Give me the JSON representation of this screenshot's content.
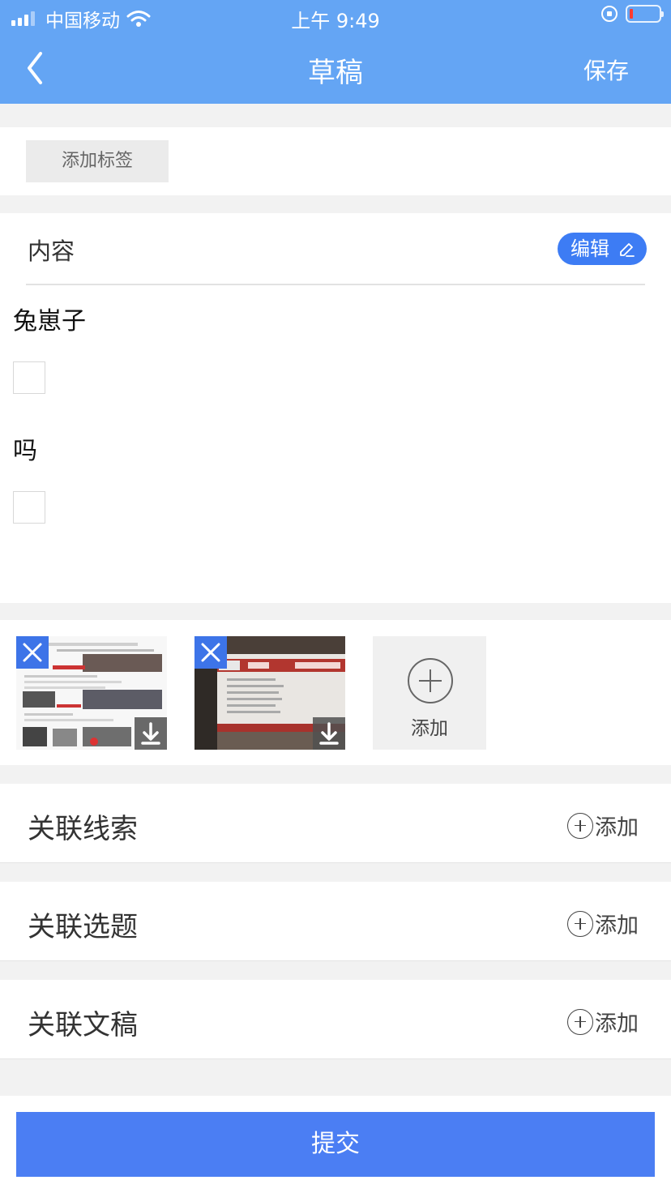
{
  "status_bar": {
    "carrier": "中国移动",
    "time": "上午 9:49"
  },
  "nav": {
    "title": "草稿",
    "save_label": "保存"
  },
  "tags": {
    "add_tag_label": "添加标签"
  },
  "content": {
    "label": "内容",
    "edit_label": "编辑",
    "blocks": [
      {
        "text": "兔崽子"
      },
      {
        "text": "吗"
      }
    ]
  },
  "media": {
    "add_label": "添加"
  },
  "links": [
    {
      "label": "关联线索",
      "add_label": "添加"
    },
    {
      "label": "关联选题",
      "add_label": "添加"
    },
    {
      "label": "关联文稿",
      "add_label": "添加"
    }
  ],
  "footer": {
    "submit_label": "提交"
  },
  "colors": {
    "header": "#64a5f4",
    "accent": "#3d7cf4",
    "submit": "#4b7ef3",
    "battery_low": "#ff3b30"
  }
}
